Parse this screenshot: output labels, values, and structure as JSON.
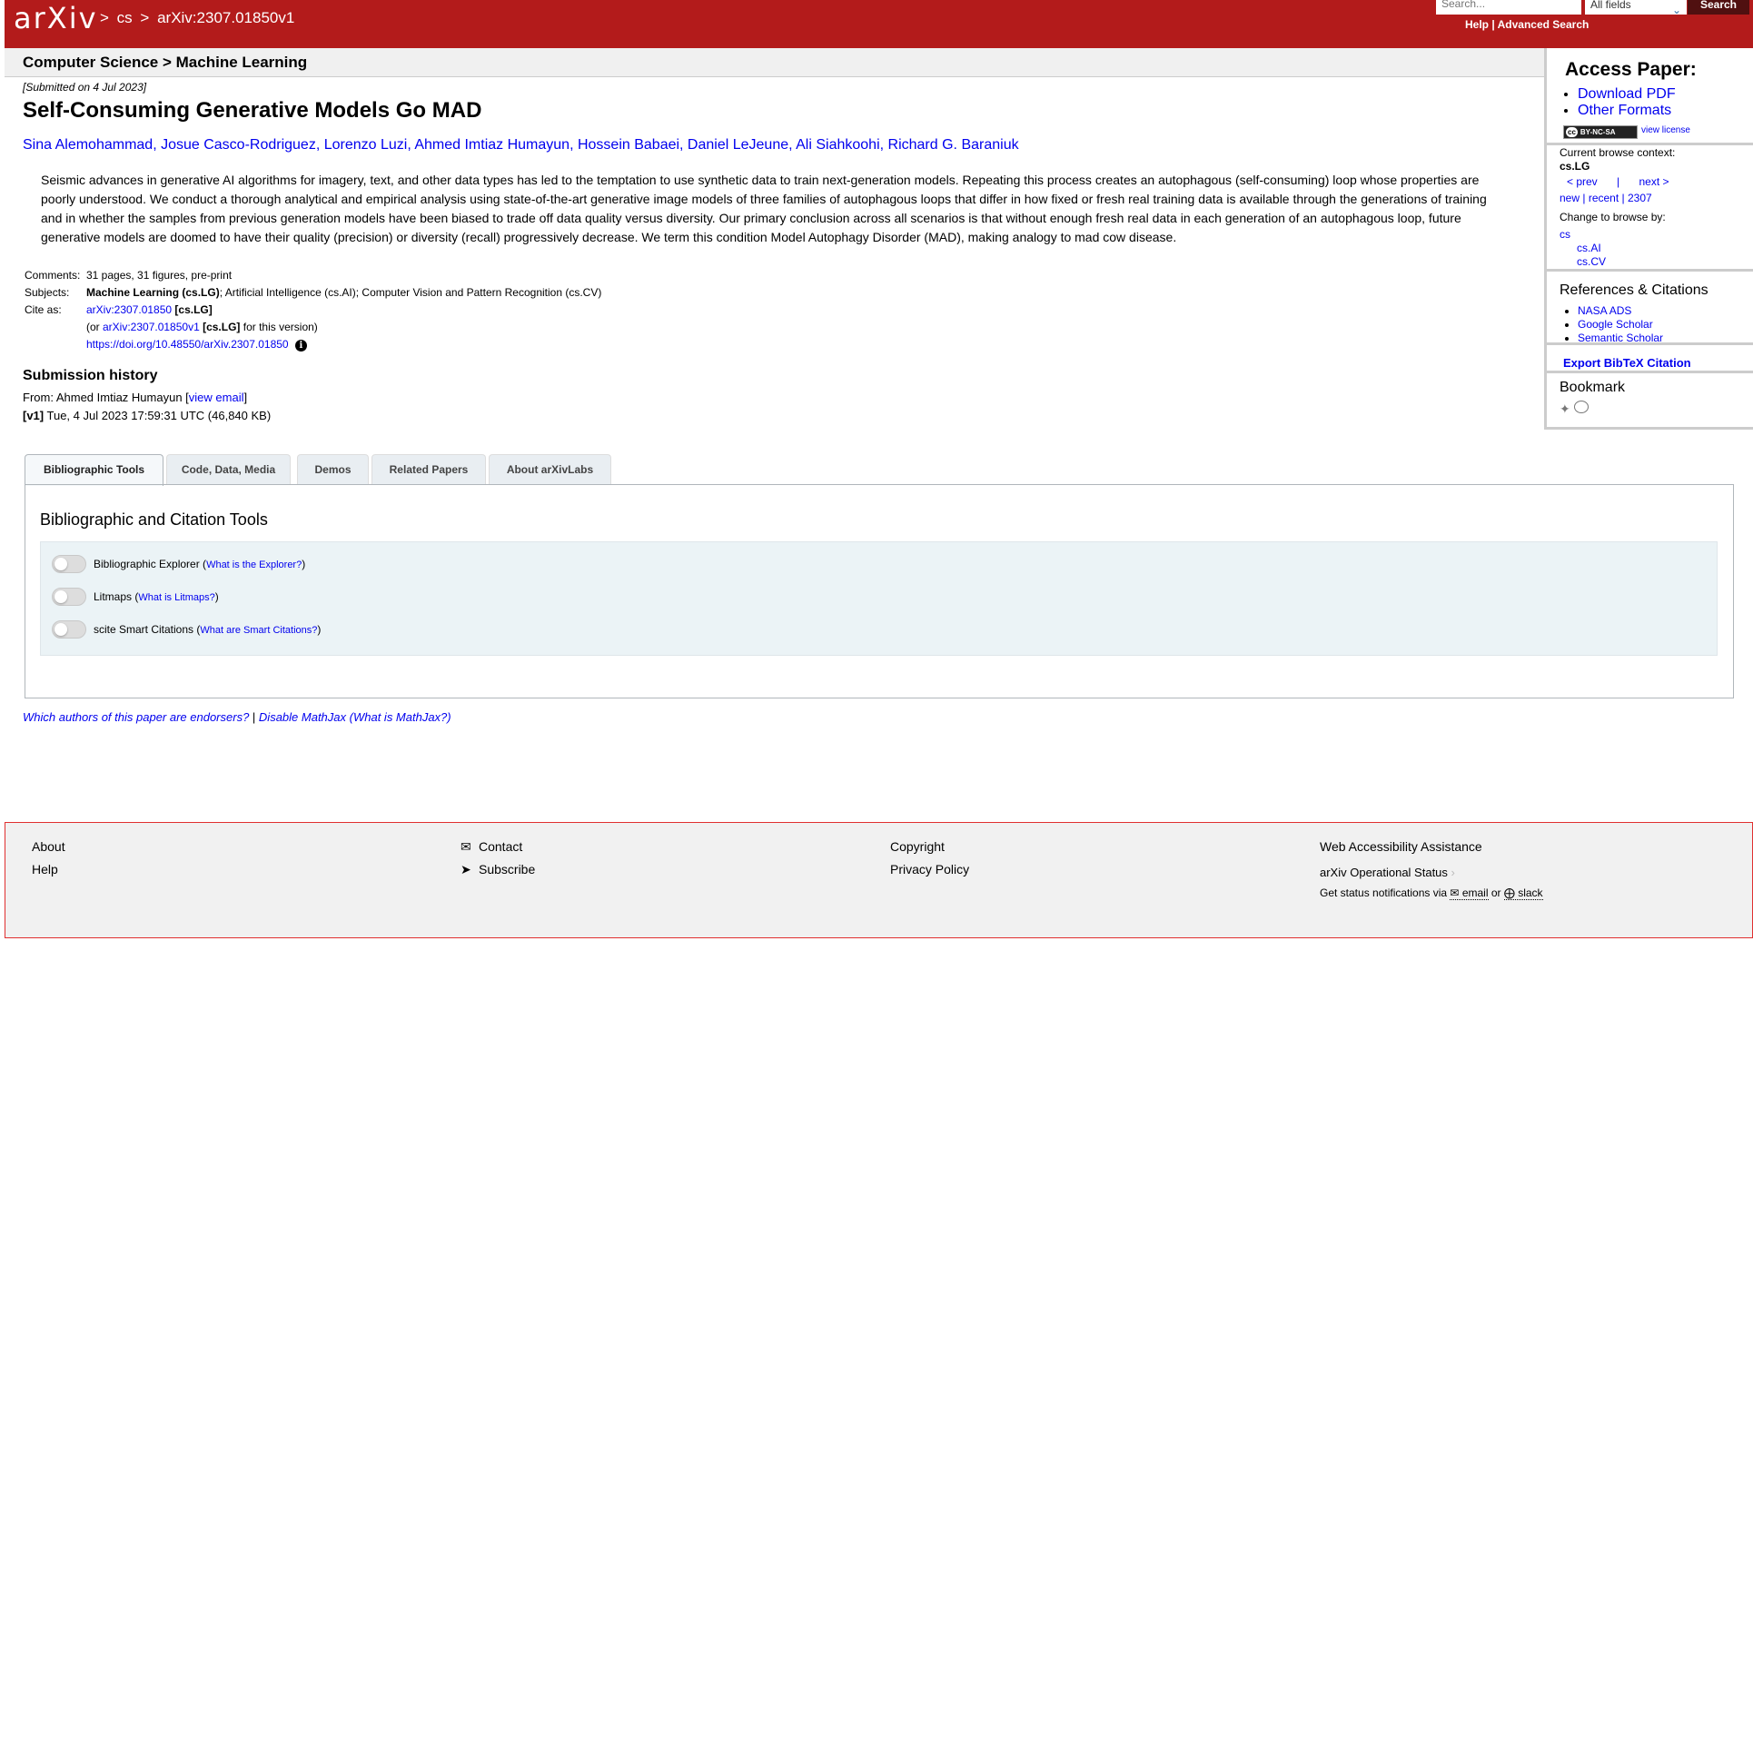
{
  "header": {
    "logo_text": "arXiv",
    "breadcrumb": [
      ">",
      "cs",
      ">",
      "arXiv:2307.01850v1"
    ],
    "search_placeholder": "Search...",
    "field_select": "All fields",
    "search_button": "Search",
    "help_link": "Help",
    "help_sep": "|",
    "advanced_search_link": "Advanced Search",
    "colors": {
      "brand": "#b31b1b"
    }
  },
  "subheader": {
    "title": "Computer Science > Machine Learning"
  },
  "paper": {
    "submitted": "[Submitted on 4 Jul 2023]",
    "title": "Self-Consuming Generative Models Go MAD",
    "authors": "Sina Alemohammad, Josue Casco-Rodriguez, Lorenzo Luzi, Ahmed Imtiaz Humayun, Hossein Babaei, Daniel LeJeune, Ali Siahkoohi, Richard G. Baraniuk",
    "abstract": "Seismic advances in generative AI algorithms for imagery, text, and other data types has led to the temptation to use synthetic data to train next-generation models. Repeating this process creates an autophagous (self-consuming) loop whose properties are poorly understood. We conduct a thorough analytical and empirical analysis using state-of-the-art generative image models of three families of autophagous loops that differ in how fixed or fresh real training data is available through the generations of training and in whether the samples from previous generation models have been biased to trade off data quality versus diversity. Our primary conclusion across all scenarios is that without enough fresh real data in each generation of an autophagous loop, future generative models are doomed to have their quality (precision) or diversity (recall) progressively decrease. We term this condition Model Autophagy Disorder (MAD), making analogy to mad cow disease."
  },
  "meta": {
    "comments_label": "Comments:",
    "comments_value": "31 pages, 31 figures, pre-print",
    "subjects_label": "Subjects:",
    "subjects_primary": "Machine Learning (cs.LG)",
    "subjects_rest": "; Artificial Intelligence (cs.AI); Computer Vision and Pattern Recognition (cs.CV)",
    "cite_label": "Cite as:",
    "cite_id": "arXiv:2307.01850",
    "cite_cat": " [cs.LG]",
    "cite_or": "(or ",
    "cite_version_id": "arXiv:2307.01850v1",
    "cite_version_cat": " [cs.LG]",
    "cite_version_tail": " for this version)",
    "doi": "https://doi.org/10.48550/arXiv.2307.01850"
  },
  "submission": {
    "title": "Submission history",
    "from_prefix": "From: Ahmed Imtiaz Humayun [",
    "view_email": "view email",
    "from_suffix": "]",
    "v1_tag": "[v1]",
    "v1_text": " Tue, 4 Jul 2023 17:59:31 UTC (46,840 KB)"
  },
  "tabs": [
    {
      "label": "Bibliographic Tools",
      "active": true
    },
    {
      "label": "Code, Data, Media",
      "active": false
    },
    {
      "label": "Demos",
      "active": false
    },
    {
      "label": "Related Papers",
      "active": false
    },
    {
      "label": "About arXivLabs",
      "active": false
    }
  ],
  "tab_panel": {
    "title": "Bibliographic and Citation Tools",
    "toggles": [
      {
        "label": "Bibliographic Explorer (",
        "link": "What is the Explorer?",
        "tail": ")",
        "on": false
      },
      {
        "label": "Litmaps (",
        "link": "What is Litmaps?",
        "tail": ")",
        "on": false
      },
      {
        "label": "scite Smart Citations (",
        "link": "What are Smart Citations?",
        "tail": ")",
        "on": false
      }
    ]
  },
  "endorsers": {
    "link1": "Which authors of this paper are endorsers?",
    "sep": " | ",
    "link2": "Disable MathJax",
    "link3": " (What is MathJax?)"
  },
  "sidebar": {
    "access_title": "Access Paper:",
    "access_links": [
      "Download PDF",
      "Other Formats"
    ],
    "license_badge": "BY-NC-SA",
    "license_cc": "cc",
    "view_license": "view license",
    "context_label": "Current browse context:",
    "context_value": "cs.LG",
    "prev": "< prev",
    "nav_sep": "|",
    "next": "next >",
    "new": "new",
    "recent": "recent",
    "month": "2307",
    "change_label": "Change to browse by:",
    "browse_cs": "cs",
    "browse_ai": "cs.AI",
    "browse_cv": "cs.CV",
    "refs_title": "References & Citations",
    "refs_links": [
      "NASA ADS",
      "Google Scholar",
      "Semantic Scholar"
    ],
    "bibtex": "Export BibTeX Citation",
    "bookmark_title": "Bookmark"
  },
  "footer": {
    "about": "About",
    "help": "Help",
    "contact": "Contact",
    "subscribe": "Subscribe",
    "copyright": "Copyright",
    "privacy": "Privacy Policy",
    "accessibility": "Web Accessibility Assistance",
    "status": "arXiv Operational Status",
    "notify_prefix": "Get status notifications via",
    "notify_email": "email",
    "notify_or": "or",
    "notify_slack": "slack"
  }
}
